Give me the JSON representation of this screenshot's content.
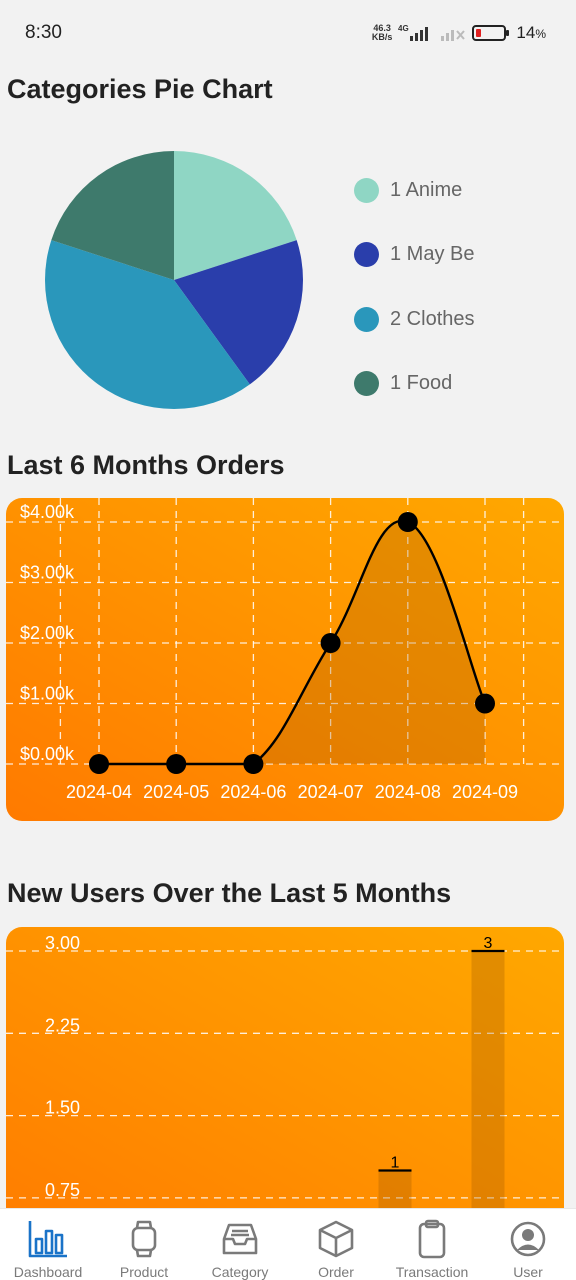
{
  "status_bar": {
    "time": "8:30",
    "net_speed_value": "46.3",
    "net_speed_unit": "KB/s",
    "network": "4G",
    "battery": "14",
    "battery_unit": "%"
  },
  "sections": {
    "pie_title": "Categories Pie Chart",
    "orders_title": "Last 6 Months Orders",
    "users_title": "New Users Over the Last 5 Months"
  },
  "chart_data": [
    {
      "type": "pie",
      "slices": [
        {
          "label": "1 Anime",
          "value": 1,
          "color": "#8fd6c4"
        },
        {
          "label": "1 May Be",
          "value": 1,
          "color": "#2a3eab"
        },
        {
          "label": "2 Clothes",
          "value": 2,
          "color": "#2a97bb"
        },
        {
          "label": "1 Food",
          "value": 1,
          "color": "#3e7a6c"
        }
      ]
    },
    {
      "type": "line",
      "x": [
        "2024-04",
        "2024-05",
        "2024-06",
        "2024-07",
        "2024-08",
        "2024-09"
      ],
      "values": [
        0,
        0,
        0,
        2000,
        4000,
        1000
      ],
      "yticks": [
        "$0.00k",
        "$1.00k",
        "$2.00k",
        "$3.00k",
        "$4.00k"
      ],
      "ylim": [
        0,
        4000
      ],
      "grid": true
    },
    {
      "type": "bar",
      "categories": [
        "",
        "",
        "",
        "",
        ""
      ],
      "values": [
        0,
        0,
        0,
        1,
        3
      ],
      "data_labels": [
        "",
        "",
        "",
        "1",
        "3"
      ],
      "yticks": [
        "0.75",
        "1.50",
        "2.25",
        "3.00"
      ],
      "ylim": [
        0,
        3
      ],
      "grid": true
    }
  ],
  "nav": {
    "items": [
      {
        "label": "Dashboard",
        "icon": "bar-chart-icon"
      },
      {
        "label": "Product",
        "icon": "watch-icon"
      },
      {
        "label": "Category",
        "icon": "inbox-icon"
      },
      {
        "label": "Order",
        "icon": "box-icon"
      },
      {
        "label": "Transaction",
        "icon": "clipboard-icon"
      },
      {
        "label": "User",
        "icon": "user-circle-icon"
      }
    ],
    "active": "Dashboard",
    "active_color": "#1a73c8",
    "inactive_color": "#7a7a7a"
  }
}
